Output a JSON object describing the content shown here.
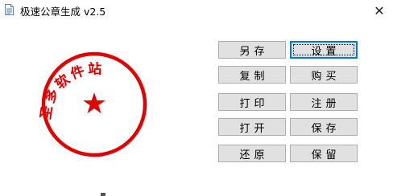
{
  "window": {
    "title": "极速公章生成 v2.5",
    "close_symbol": "✕"
  },
  "stamp": {
    "text": "圣多软件站",
    "star": "★",
    "color": "#e30000"
  },
  "buttons": {
    "save_as": "另存",
    "settings": "设置",
    "copy": "复制",
    "buy": "购买",
    "print": "打印",
    "register": "注册",
    "open": "打开",
    "save": "保存",
    "restore": "还原",
    "keep": "保留"
  },
  "icons": {
    "app": "document-icon",
    "close": "close-icon",
    "star": "star-icon"
  }
}
